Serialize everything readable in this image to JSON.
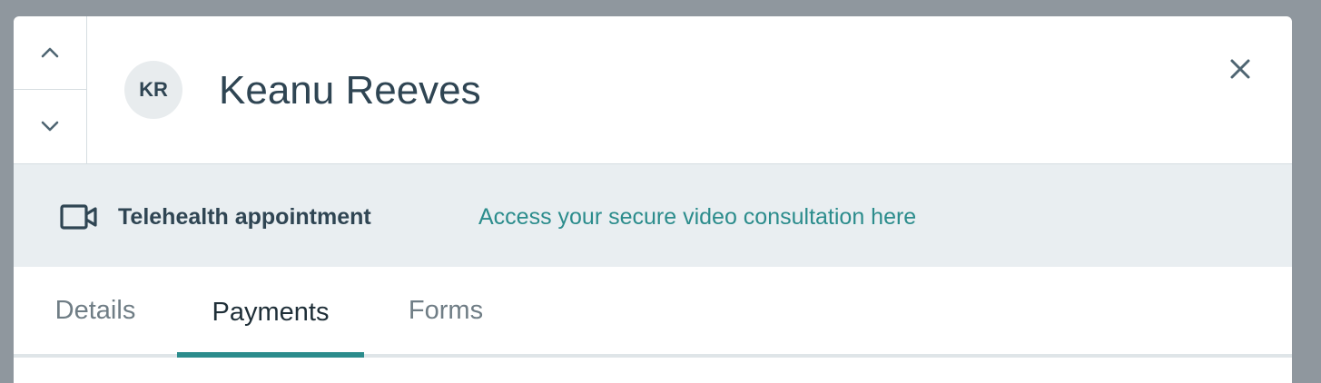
{
  "header": {
    "initials": "KR",
    "name": "Keanu Reeves"
  },
  "nav": {
    "up_icon": "chevron-up-icon",
    "down_icon": "chevron-down-icon",
    "close_icon": "close-icon"
  },
  "telehealth": {
    "icon": "video-camera-icon",
    "label": "Telehealth appointment",
    "link_text": "Access your secure video consultation here"
  },
  "tabs": [
    {
      "label": "Details",
      "active": false
    },
    {
      "label": "Payments",
      "active": true
    },
    {
      "label": "Forms",
      "active": false
    }
  ],
  "colors": {
    "accent": "#2b8c8c",
    "text_dark": "#2f4553",
    "banner_bg": "#e9eef1",
    "overlay_bg": "#8f979e"
  }
}
